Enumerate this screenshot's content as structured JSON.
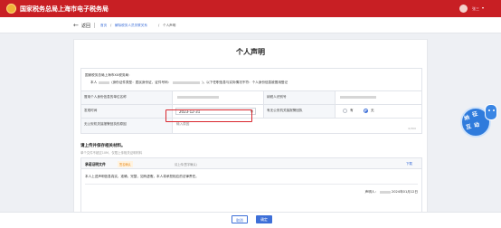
{
  "header": {
    "site_title": "国家税务总局上海市电子税务局",
    "user_name": "张三",
    "caret": "▾"
  },
  "breadcrumb": {
    "back_icon": "←",
    "back_label": "返回",
    "home": "首页",
    "middle": "解除税务人员关联关系",
    "current": "个人声明"
  },
  "form": {
    "title": "个人声明",
    "declaration_line1": "国家税务总局上海市XX税务局：",
    "declaration_line2_prefix": "本人",
    "declaration_line2_mid": "(身份证件类型：居民身份证，证件号码：",
    "declaration_line2_suffix": ")，以下任职信息与实际情况不符：个人身份信息被冒用登记",
    "fields": {
      "company_label": "冒用个人身份信息的单位名称",
      "tax_id_label": "纳税人识别号",
      "discover_time_label": "发现时间",
      "discover_time_value": "2023-12-31",
      "reported_label": "有无公安机关接报警回执",
      "reported_yes": "有",
      "reported_no": "无",
      "no_receipt_reason_label": "无公安机关接报警回执的原因",
      "reason_placeholder": "输入原因",
      "reason_counter": "0/300"
    },
    "note_title": "请上传并保存相关材料。",
    "note_sub": "单个文件不超过10M，仅限上传相关证明材料",
    "sign": {
      "label": "承诺证明文件",
      "tag": "签名确认",
      "date_hint": "请上传(签字确认)",
      "link": "下载",
      "text": "本人上述声明信息真实、准确、完整，如有虚假，本人将承担相应的法律责任。",
      "signer_label": "声明人：",
      "date": "2024年01月12日"
    }
  },
  "footer": {
    "cancel": "取消",
    "confirm": "确定"
  },
  "float_badge": {
    "text1": "征",
    "text2": "纳",
    "text3": "互",
    "text4": "动"
  },
  "colors": {
    "brand_red": "#c81f24",
    "accent_blue": "#3d6fd8",
    "highlight_red": "#d9272e"
  }
}
